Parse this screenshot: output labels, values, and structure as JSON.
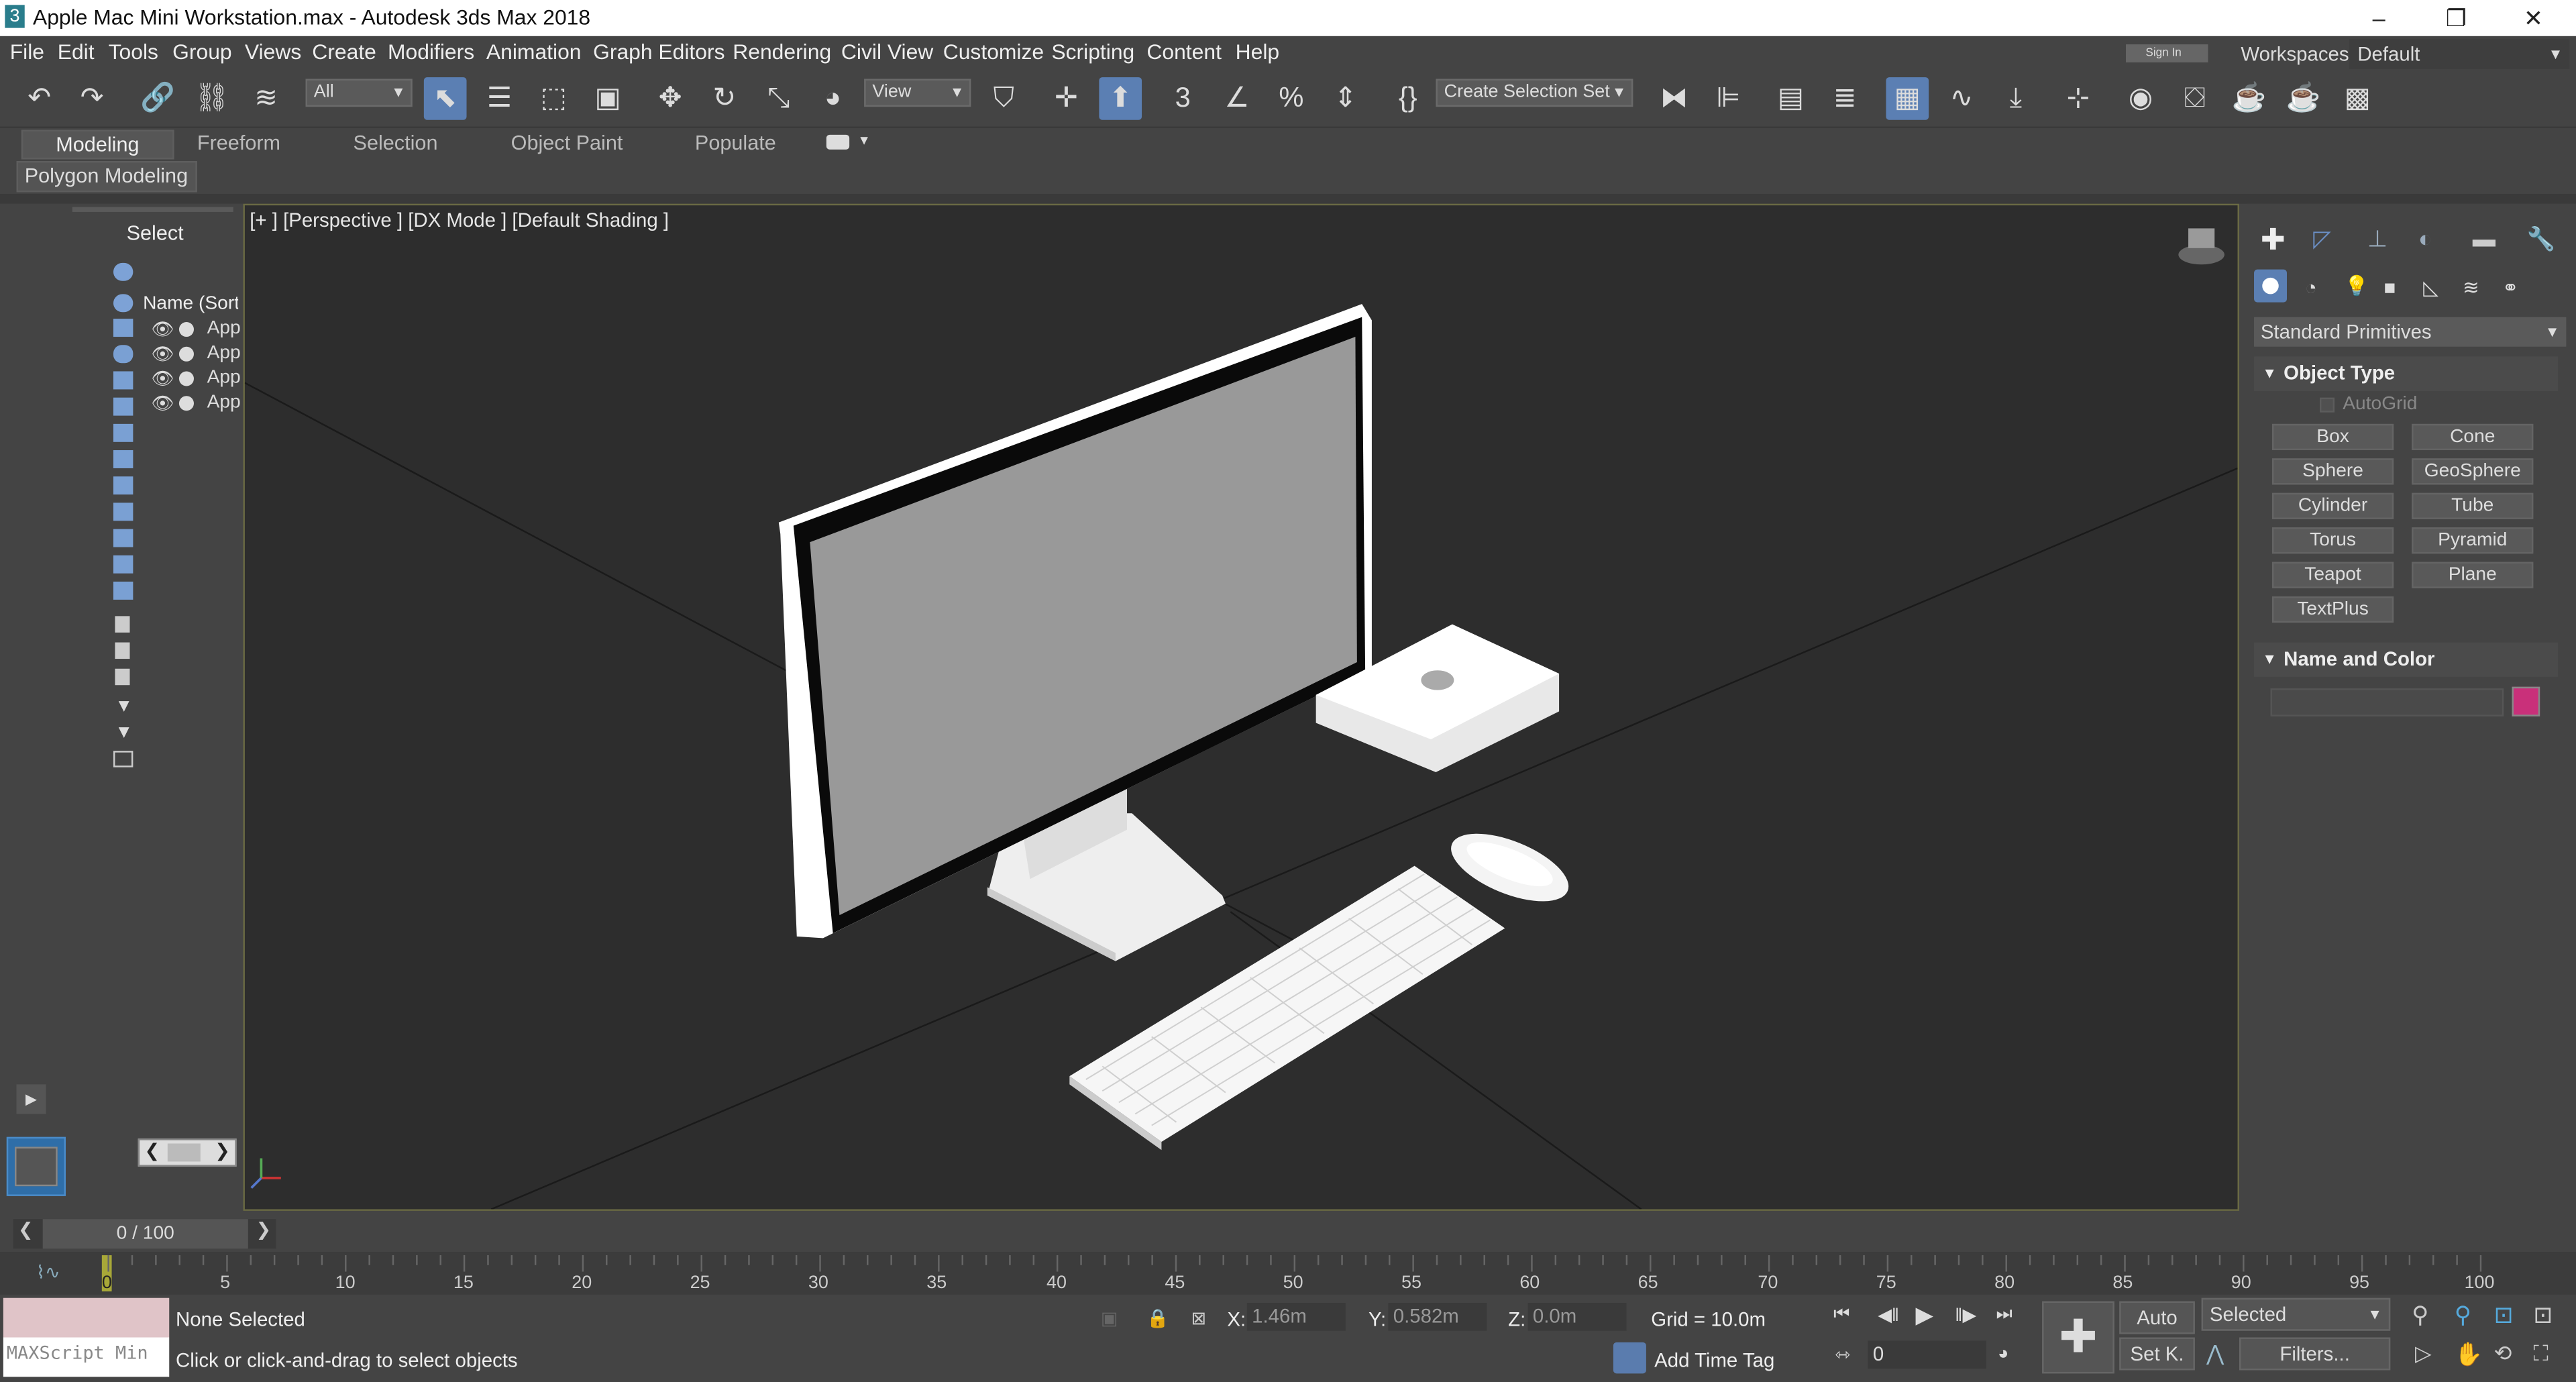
{
  "window": {
    "app_icon": "3",
    "title": "Apple Mac Mini Workstation.max - Autodesk 3ds Max 2018",
    "minimize": "–",
    "restore": "❐",
    "close": "✕"
  },
  "menu": [
    "File",
    "Edit",
    "Tools",
    "Group",
    "Views",
    "Create",
    "Modifiers",
    "Animation",
    "Graph Editors",
    "Rendering",
    "Civil View",
    "Customize",
    "Scripting",
    "Content",
    "Help"
  ],
  "signin": "Sign In",
  "workspaces": {
    "label": "Workspaces:",
    "value": "Default"
  },
  "toolbar": {
    "filter_value": "All",
    "refcoord_value": "View",
    "selection_set": "Create Selection Set"
  },
  "ribbon": {
    "tabs": [
      "Modeling",
      "Freeform",
      "Selection",
      "Object Paint",
      "Populate"
    ],
    "active_tab": "Modeling",
    "sub": "Polygon Modeling"
  },
  "scene_explorer": {
    "select_label": "Select",
    "column": "Name (Sort",
    "items": [
      "App",
      "App",
      "App",
      "App"
    ]
  },
  "viewport": {
    "label": "[+ ] [Perspective ] [DX Mode ] [Default Shading ]"
  },
  "command_panel": {
    "category": "Standard Primitives",
    "object_type_title": "Object Type",
    "autogrid": "AutoGrid",
    "buttons": [
      "Box",
      "Cone",
      "Sphere",
      "GeoSphere",
      "Cylinder",
      "Tube",
      "Torus",
      "Pyramid",
      "Teapot",
      "Plane",
      "TextPlus"
    ],
    "name_color_title": "Name and Color",
    "color": "#c9307a"
  },
  "time": {
    "frame_display": "0 / 100",
    "ticks": [
      "0",
      "5",
      "10",
      "15",
      "20",
      "25",
      "30",
      "35",
      "40",
      "45",
      "50",
      "55",
      "60",
      "65",
      "70",
      "75",
      "80",
      "85",
      "90",
      "95",
      "100"
    ]
  },
  "status": {
    "maxscript": "MAXScript Min",
    "selection": "None Selected",
    "prompt": "Click or click-and-drag to select objects",
    "x_label": "X:",
    "x_value": "1.46m",
    "y_label": "Y:",
    "y_value": "0.582m",
    "z_label": "Z:",
    "z_value": "0.0m",
    "grid": "Grid = 10.0m",
    "add_time_tag": "Add Time Tag",
    "auto": "Auto",
    "setk": "Set K.",
    "selected": "Selected",
    "filters": "Filters...",
    "frame": "0"
  }
}
